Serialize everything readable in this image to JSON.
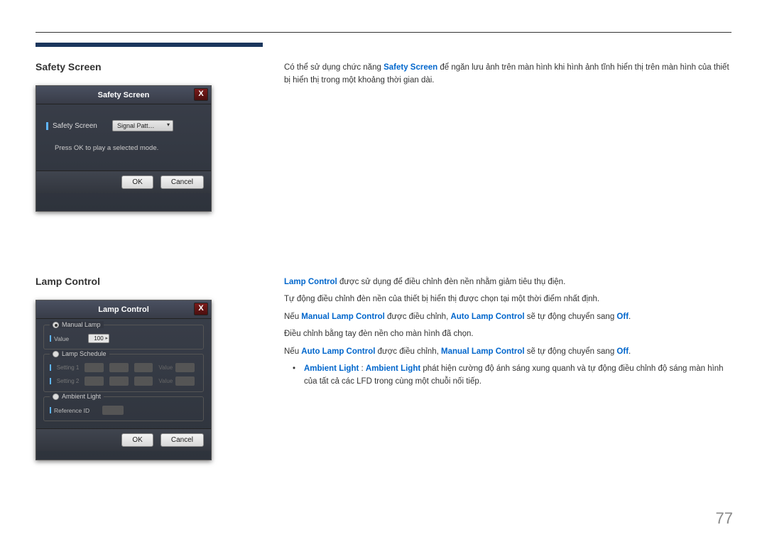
{
  "page_number": "77",
  "sections": {
    "safety": {
      "title": "Safety Screen",
      "dialog": {
        "title": "Safety Screen",
        "label": "Safety Screen",
        "select_value": "Signal Patt…",
        "note": "Press OK to play a selected mode.",
        "ok": "OK",
        "cancel": "Cancel",
        "close": "X"
      },
      "text": {
        "p1_a": "Có thể sử dụng chức năng ",
        "p1_key": "Safety Screen",
        "p1_b": " để ngăn lưu ảnh trên màn hình khi hình ảnh tĩnh hiển thị trên màn hình của thiết bị hiển thị trong một khoảng thời gian dài."
      }
    },
    "lamp": {
      "title": "Lamp Control",
      "dialog": {
        "title": "Lamp Control",
        "group1": "Manual Lamp",
        "value_label": "Value",
        "value": "100",
        "group2": "Lamp Schedule",
        "setting1": "Setting 1",
        "setting2": "Setting 2",
        "sched_value": "Value",
        "group3": "Ambient Light",
        "reference": "Reference ID",
        "ok": "OK",
        "cancel": "Cancel",
        "close": "X"
      },
      "text": {
        "p1_key": "Lamp Control",
        "p1_b": " được sử dụng để điều chỉnh đèn nền nhằm giảm tiêu thụ điện.",
        "p2": "Tự động điều chỉnh đèn nền của thiết bị hiển thị được chọn tại một thời điểm nhất định.",
        "p3_a": "Nếu ",
        "p3_k1": "Manual Lamp Control",
        "p3_b": " được điều chỉnh, ",
        "p3_k2": "Auto Lamp Control",
        "p3_c": " sẽ tự động chuyển sang ",
        "p3_k3": "Off",
        "p3_d": ".",
        "p4": "Điều chỉnh bằng tay đèn nền cho màn hình đã chọn.",
        "p5_a": "Nếu ",
        "p5_k1": "Auto Lamp Control",
        "p5_b": " được điều chỉnh, ",
        "p5_k2": "Manual Lamp Control",
        "p5_c": " sẽ tự động chuyển sang ",
        "p5_k3": "Off",
        "p5_d": ".",
        "b1_k1": "Ambient Light",
        "b1_a": " : ",
        "b1_k2": "Ambient Light",
        "b1_b": " phát hiện cường độ ánh sáng xung quanh và tự động điều chỉnh độ sáng màn hình của tất cả các LFD trong cùng một chuỗi nối tiếp."
      }
    }
  }
}
